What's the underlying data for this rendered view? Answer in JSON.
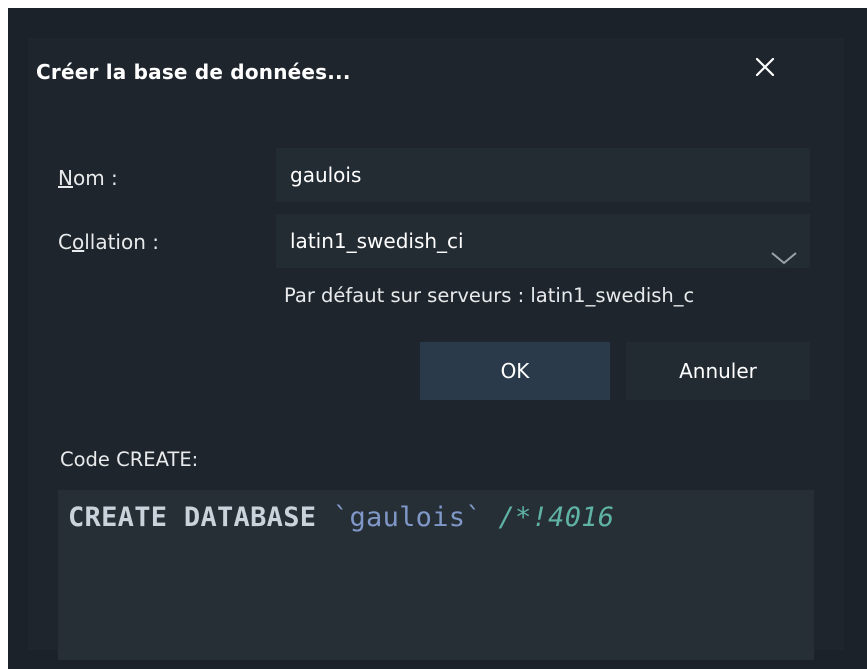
{
  "dialog": {
    "title": "Créer la base de données...",
    "close_icon": "close-icon"
  },
  "form": {
    "name_label_first": "N",
    "name_label_rest": "om :",
    "name_value": "gaulois",
    "collation_label_first": "C",
    "collation_label_underlined": "o",
    "collation_label_rest": "llation :",
    "collation_value": "latin1_swedish_ci",
    "collation_dropdown_icon": "chevron-down-icon",
    "server_default_hint": "Par défaut sur serveurs : latin1_swedish_c"
  },
  "buttons": {
    "ok_label": "OK",
    "cancel_label": "Annuler"
  },
  "code": {
    "label": "Code CREATE:",
    "keyword": "CREATE DATABASE",
    "identifier": "`gaulois`",
    "comment": "/*!4016"
  },
  "colors": {
    "background": "#1b2229",
    "panel": "#1e252c",
    "field": "#232b33",
    "ok_button": "#2a3a4a",
    "keyword": "#c9d3dc",
    "identifier": "#7f98c8",
    "comment": "#5fb3a5"
  }
}
